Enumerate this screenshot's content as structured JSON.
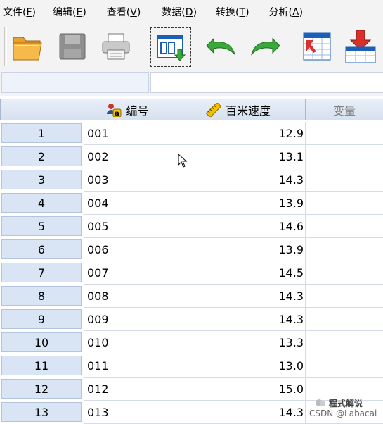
{
  "menu": [
    {
      "label": "文件(",
      "key": "F",
      "end": ")"
    },
    {
      "label": "编辑(",
      "key": "E",
      "end": ")"
    },
    {
      "label": "查看(",
      "key": "V",
      "end": ")"
    },
    {
      "label": "数据(",
      "key": "D",
      "end": ")"
    },
    {
      "label": "转换(",
      "key": "T",
      "end": ")"
    },
    {
      "label": "分析(",
      "key": "A",
      "end": ")"
    }
  ],
  "toolbar": {
    "icons": [
      "open-folder-icon",
      "save-icon",
      "print-icon",
      "recall-dialog-icon",
      "undo-icon",
      "redo-icon",
      "goto-case-icon",
      "goto-variable-icon"
    ],
    "colors": {
      "folder": "#f0a02a",
      "save": "#8a8a8a",
      "undo": "#3aa83a",
      "accent": "#1b5fb8",
      "red": "#d9302a"
    }
  },
  "editbar": {
    "cell_ref": "",
    "cell_value": ""
  },
  "grid": {
    "columns": [
      {
        "name": "编号",
        "icon": "string-variable-icon"
      },
      {
        "name": "百米速度",
        "icon": "scale-variable-icon"
      },
      {
        "name": "变量",
        "icon": ""
      }
    ],
    "rows": [
      {
        "n": "1",
        "id": "001",
        "speed": "12.9"
      },
      {
        "n": "2",
        "id": "002",
        "speed": "13.1"
      },
      {
        "n": "3",
        "id": "003",
        "speed": "14.3"
      },
      {
        "n": "4",
        "id": "004",
        "speed": "13.9"
      },
      {
        "n": "5",
        "id": "005",
        "speed": "14.6"
      },
      {
        "n": "6",
        "id": "006",
        "speed": "13.9"
      },
      {
        "n": "7",
        "id": "007",
        "speed": "14.5"
      },
      {
        "n": "8",
        "id": "008",
        "speed": "14.3"
      },
      {
        "n": "9",
        "id": "009",
        "speed": "14.3"
      },
      {
        "n": "10",
        "id": "010",
        "speed": "13.3"
      },
      {
        "n": "11",
        "id": "011",
        "speed": "13.0"
      },
      {
        "n": "12",
        "id": "012",
        "speed": "15.0"
      },
      {
        "n": "13",
        "id": "013",
        "speed": "14.3"
      }
    ]
  },
  "watermark": {
    "top": "程式解说",
    "bottom": "CSDN @Labacai"
  }
}
